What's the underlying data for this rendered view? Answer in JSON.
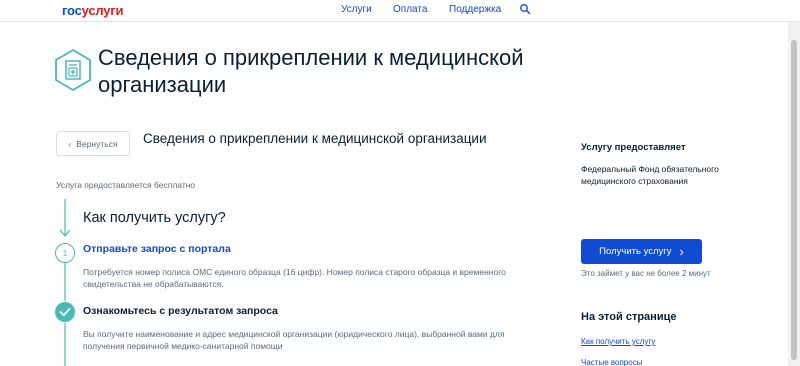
{
  "header": {
    "logo_part1": "гос",
    "logo_part2": "услуги",
    "nav": [
      {
        "label": "Услуги"
      },
      {
        "label": "Оплата"
      },
      {
        "label": "Поддержка"
      }
    ],
    "search_icon": "search-icon"
  },
  "page": {
    "title": "Сведения о прикреплении к медицинской организации",
    "title_icon": "hospital-document-icon",
    "back_label": "Вернуться",
    "subtitle": "Сведения о прикреплении к медицинской организации",
    "free_note": "Услуга предоставляется бесплатно"
  },
  "steps": {
    "how_title": "Как получить услугу?",
    "step1": {
      "number": "1",
      "title": "Отправьте запрос с портала",
      "desc": "Потребуется номер полиса ОМС единого образца (16 цифр). Номер полиса старого образца и временного свидетельства не обрабатываются."
    },
    "step2": {
      "title": "Ознакомьтесь с результатом запроса",
      "desc": "Вы получите наименование и адрес медицинской организации (юридического лица), выбранной вами для получения первичной медико-санитарной помощи"
    }
  },
  "sidebar": {
    "provider_head": "Услугу предоставляет",
    "provider_name": "Федеральный Фонд обязательного медицинского страхования",
    "get_button": "Получить услугу",
    "time_note": "Это займет у вас не более 2 минут",
    "onpage_head": "На этой странице",
    "links": [
      {
        "label": "Как получить услугу"
      },
      {
        "label": "Частые вопросы"
      }
    ]
  },
  "colors": {
    "brand_blue": "#0d4cd3",
    "brand_red": "#e21a1a",
    "teal": "#4ab8b3"
  }
}
